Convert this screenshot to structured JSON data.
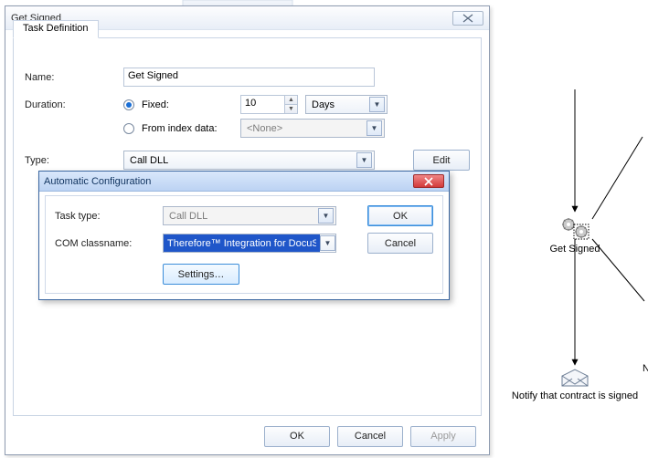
{
  "dialog": {
    "title": "Get Signed",
    "tab": "Task Definition",
    "name_label": "Name:",
    "name_value": "Get Signed",
    "duration_label": "Duration:",
    "fixed_label": "Fixed:",
    "fixed_value": "10",
    "fixed_unit": "Days",
    "fromindex_label": "From index data:",
    "fromindex_value": "<None>",
    "type_label": "Type:",
    "type_value": "Call DLL",
    "edit_label": "Edit",
    "ok_label": "OK",
    "cancel_label": "Cancel",
    "apply_label": "Apply"
  },
  "modal": {
    "title": "Automatic Configuration",
    "tasktype_label": "Task type:",
    "tasktype_value": "Call DLL",
    "classname_label": "COM classname:",
    "classname_value": "Therefore™ Integration for DocuSign",
    "settings_label": "Settings…",
    "ok_label": "OK",
    "cancel_label": "Cancel"
  },
  "diagram": {
    "node1_label": "Get Signed",
    "node2_label": "Notify that contract is signed"
  }
}
